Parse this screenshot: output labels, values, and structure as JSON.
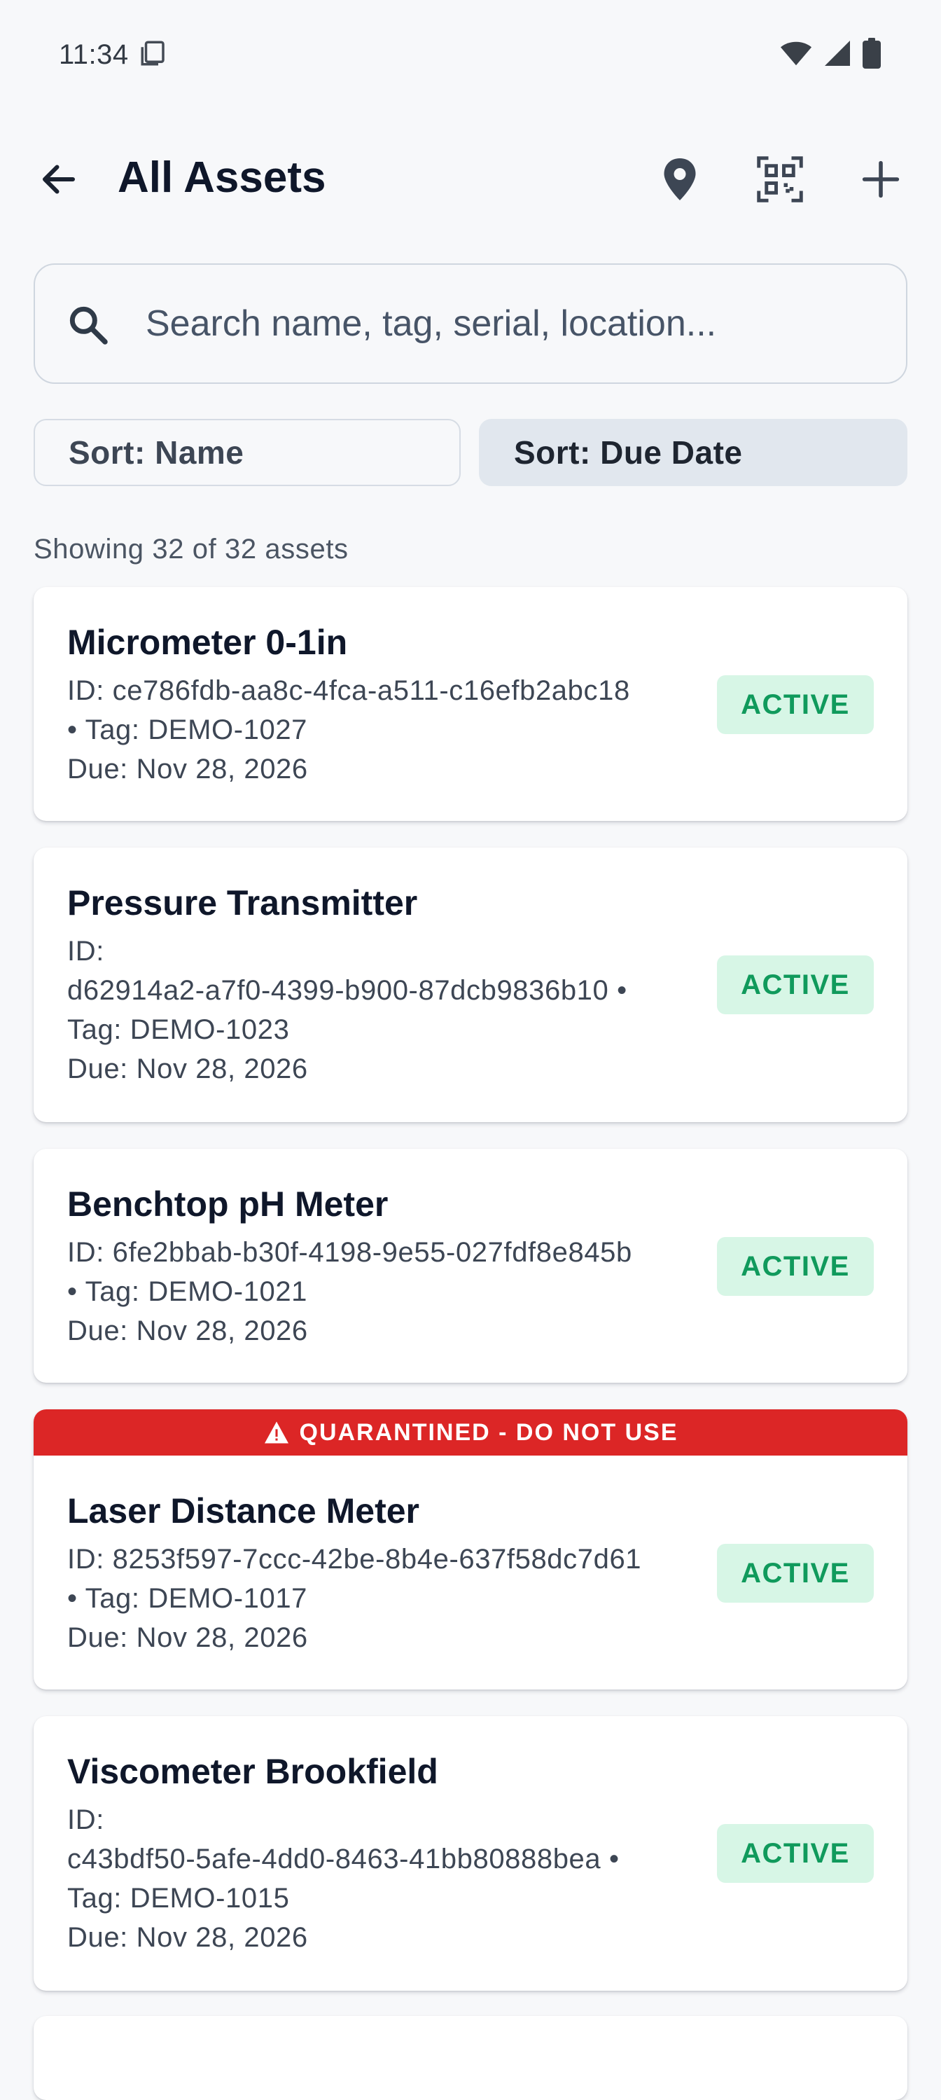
{
  "status_bar": {
    "time": "11:34",
    "icons": [
      "screenshot-icon",
      "wifi-icon",
      "signal-icon",
      "battery-icon"
    ]
  },
  "app_bar": {
    "title": "All Assets",
    "actions": [
      "location-pin-icon",
      "qr-scan-icon",
      "add-icon"
    ]
  },
  "search": {
    "placeholder": "Search name, tag, serial, location..."
  },
  "sort": {
    "name_label": "Sort: Name",
    "due_label": "Sort: Due Date",
    "selected": "Sort: Due Date"
  },
  "showing_text": "Showing 32 of 32 assets",
  "colors": {
    "active_badge_bg": "#d7f6e6",
    "active_badge_text": "#109a5c",
    "quarantine_banner": "#dc2626",
    "sort_selected_bg": "#e1e7ee"
  },
  "assets": [
    {
      "name": "Micrometer 0-1in",
      "meta_lines": [
        "ID: ce786fdb-aa8c-4fca-a511-c16efb2abc18",
        "• Tag: DEMO-1027",
        "Due: Nov 28, 2026"
      ],
      "status": "ACTIVE"
    },
    {
      "name": "Pressure Transmitter",
      "meta_lines": [
        "ID:",
        "d62914a2-a7f0-4399-b900-87dcb9836b10 •",
        "Tag: DEMO-1023",
        "Due: Nov 28, 2026"
      ],
      "status": "ACTIVE"
    },
    {
      "name": "Benchtop pH Meter",
      "meta_lines": [
        "ID: 6fe2bbab-b30f-4198-9e55-027fdf8e845b",
        "• Tag: DEMO-1021",
        "Due: Nov 28, 2026"
      ],
      "status": "ACTIVE"
    },
    {
      "banner": "QUARANTINED - DO NOT USE",
      "name": "Laser Distance Meter",
      "meta_lines": [
        "ID: 8253f597-7ccc-42be-8b4e-637f58dc7d61",
        "• Tag: DEMO-1017",
        "Due: Nov 28, 2026"
      ],
      "status": "ACTIVE"
    },
    {
      "name": "Viscometer Brookfield",
      "meta_lines": [
        "ID:",
        "c43bdf50-5afe-4dd0-8463-41bb80888bea •",
        "Tag: DEMO-1015",
        "Due: Nov 28, 2026"
      ],
      "status": "ACTIVE"
    }
  ]
}
